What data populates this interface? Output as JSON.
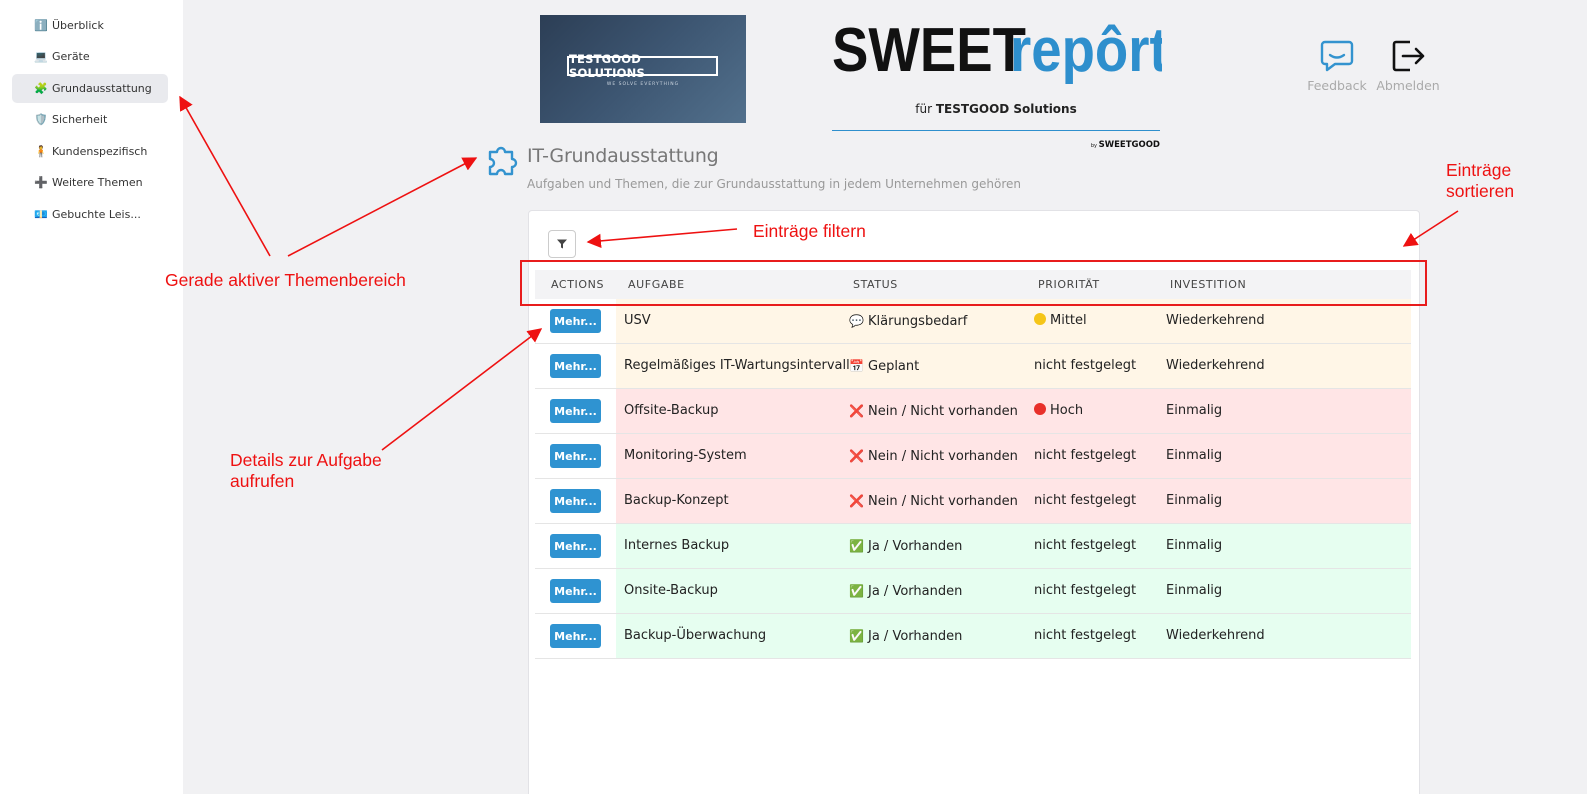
{
  "sidebar": {
    "items": [
      {
        "icon": "ℹ️",
        "label": "Überblick"
      },
      {
        "icon": "💻",
        "label": "Geräte"
      },
      {
        "icon": "🧩",
        "label": "Grundausstattung"
      },
      {
        "icon": "🛡️",
        "label": "Sicherheit"
      },
      {
        "icon": "🧍",
        "label": "Kundenspezifisch"
      },
      {
        "icon": "➕",
        "label": "Weitere Themen"
      },
      {
        "icon": "💶",
        "label": "Gebuchte Leis..."
      }
    ]
  },
  "header": {
    "company_logo_text": "TESTGOOD SOLUTIONS",
    "company_logo_tagline": "WE SOLVE EVERYTHING",
    "brand_dark": "SWEET",
    "brand_blue": "repôrt",
    "brand_for": "für ",
    "brand_company": "TESTGOOD Solutions",
    "brand_by": "by ",
    "brand_by_name": "SWEETGOOD",
    "feedback_label": "Feedback",
    "logout_label": "Abmelden"
  },
  "page": {
    "title": "IT-Grundausstattung",
    "subtitle": "Aufgaben und Themen, die zur Grundausstattung in jedem Unternehmen gehören"
  },
  "table": {
    "headers": {
      "actions": "ACTIONS",
      "task": "AUFGABE",
      "status": "STATUS",
      "priority": "PRIORITÄT",
      "investment": "INVESTITION"
    },
    "button_label": "Mehr...",
    "rows": [
      {
        "task": "USV",
        "status_icon": "💬",
        "status": "Klärungsbedarf",
        "priority_dot": "#f5c518",
        "priority": "Mittel",
        "investment": "Wiederkehrend",
        "bg": "#fff6e7"
      },
      {
        "task": "Regelmäßiges IT-Wartungsintervall",
        "status_icon": "📅",
        "status": "Geplant",
        "priority_dot": "",
        "priority": "nicht festgelegt",
        "investment": "Wiederkehrend",
        "bg": "#fff6e7"
      },
      {
        "task": "Offsite-Backup",
        "status_icon": "❌",
        "status": "Nein / Nicht vorhanden",
        "priority_dot": "#e8302a",
        "priority": "Hoch",
        "investment": "Einmalig",
        "bg": "#ffe5e6"
      },
      {
        "task": "Monitoring-System",
        "status_icon": "❌",
        "status": "Nein / Nicht vorhanden",
        "priority_dot": "",
        "priority": "nicht festgelegt",
        "investment": "Einmalig",
        "bg": "#ffe5e6"
      },
      {
        "task": "Backup-Konzept",
        "status_icon": "❌",
        "status": "Nein / Nicht vorhanden",
        "priority_dot": "",
        "priority": "nicht festgelegt",
        "investment": "Einmalig",
        "bg": "#ffe5e6"
      },
      {
        "task": "Internes Backup",
        "status_icon": "✅",
        "status": "Ja / Vorhanden",
        "priority_dot": "",
        "priority": "nicht festgelegt",
        "investment": "Einmalig",
        "bg": "#e6fef0"
      },
      {
        "task": "Onsite-Backup",
        "status_icon": "✅",
        "status": "Ja / Vorhanden",
        "priority_dot": "",
        "priority": "nicht festgelegt",
        "investment": "Einmalig",
        "bg": "#e6fef0"
      },
      {
        "task": "Backup-Überwachung",
        "status_icon": "✅",
        "status": "Ja / Vorhanden",
        "priority_dot": "",
        "priority": "nicht festgelegt",
        "investment": "Wiederkehrend",
        "bg": "#e6fef0"
      }
    ]
  },
  "annotations": {
    "active_area": "Gerade aktiver Themenbereich",
    "filter": "Einträge filtern",
    "sort_line1": "Einträge",
    "sort_line2": "sortieren",
    "details_line1": "Details zur Aufgabe",
    "details_line2": "aufrufen"
  },
  "colors": {
    "accent": "#2f93d1",
    "annotation": "#ee1111"
  }
}
